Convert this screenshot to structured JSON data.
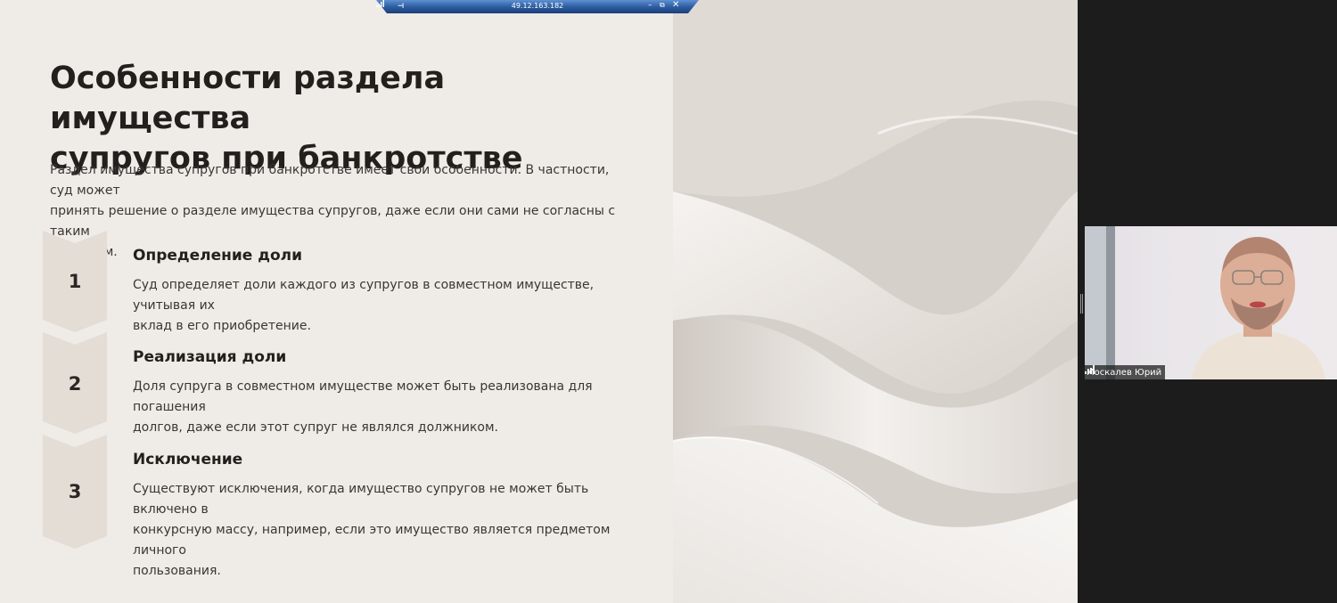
{
  "remote_session": {
    "ip_address": "49.12.163.182"
  },
  "slide": {
    "title_line1": "Особенности раздела имущества",
    "title_line2": "супругов при банкротстве",
    "intro_line1": "Раздел имущества супругов при банкротстве имеет свои особенности. В частности, суд может",
    "intro_line2": "принять решение о разделе имущества супругов, даже если они сами не согласны с таким",
    "intro_line3": "разделом.",
    "steps": [
      {
        "number": "1",
        "heading": "Определение доли",
        "lines": [
          "Суд определяет доли каждого из супругов в совместном имуществе, учитывая их",
          "вклад в его приобретение."
        ]
      },
      {
        "number": "2",
        "heading": "Реализация доли",
        "lines": [
          "Доля супруга в совместном имуществе может быть реализована для погашения",
          "долгов, даже если этот супруг не являлся должником."
        ]
      },
      {
        "number": "3",
        "heading": "Исключение",
        "lines": [
          "Существуют исключения, когда имущество супругов не может быть включено в",
          "конкурсную массу, например, если это имущество является предметом личного",
          "пользования."
        ]
      }
    ]
  },
  "participant": {
    "name": "Москалев Юрий"
  },
  "colors": {
    "slide_background": "#efebe7",
    "step_marker": "#e4ddd5",
    "title_text": "#231f1c",
    "rdp_bar": "#2d5fa3",
    "panel_background": "#1c1c1c"
  }
}
